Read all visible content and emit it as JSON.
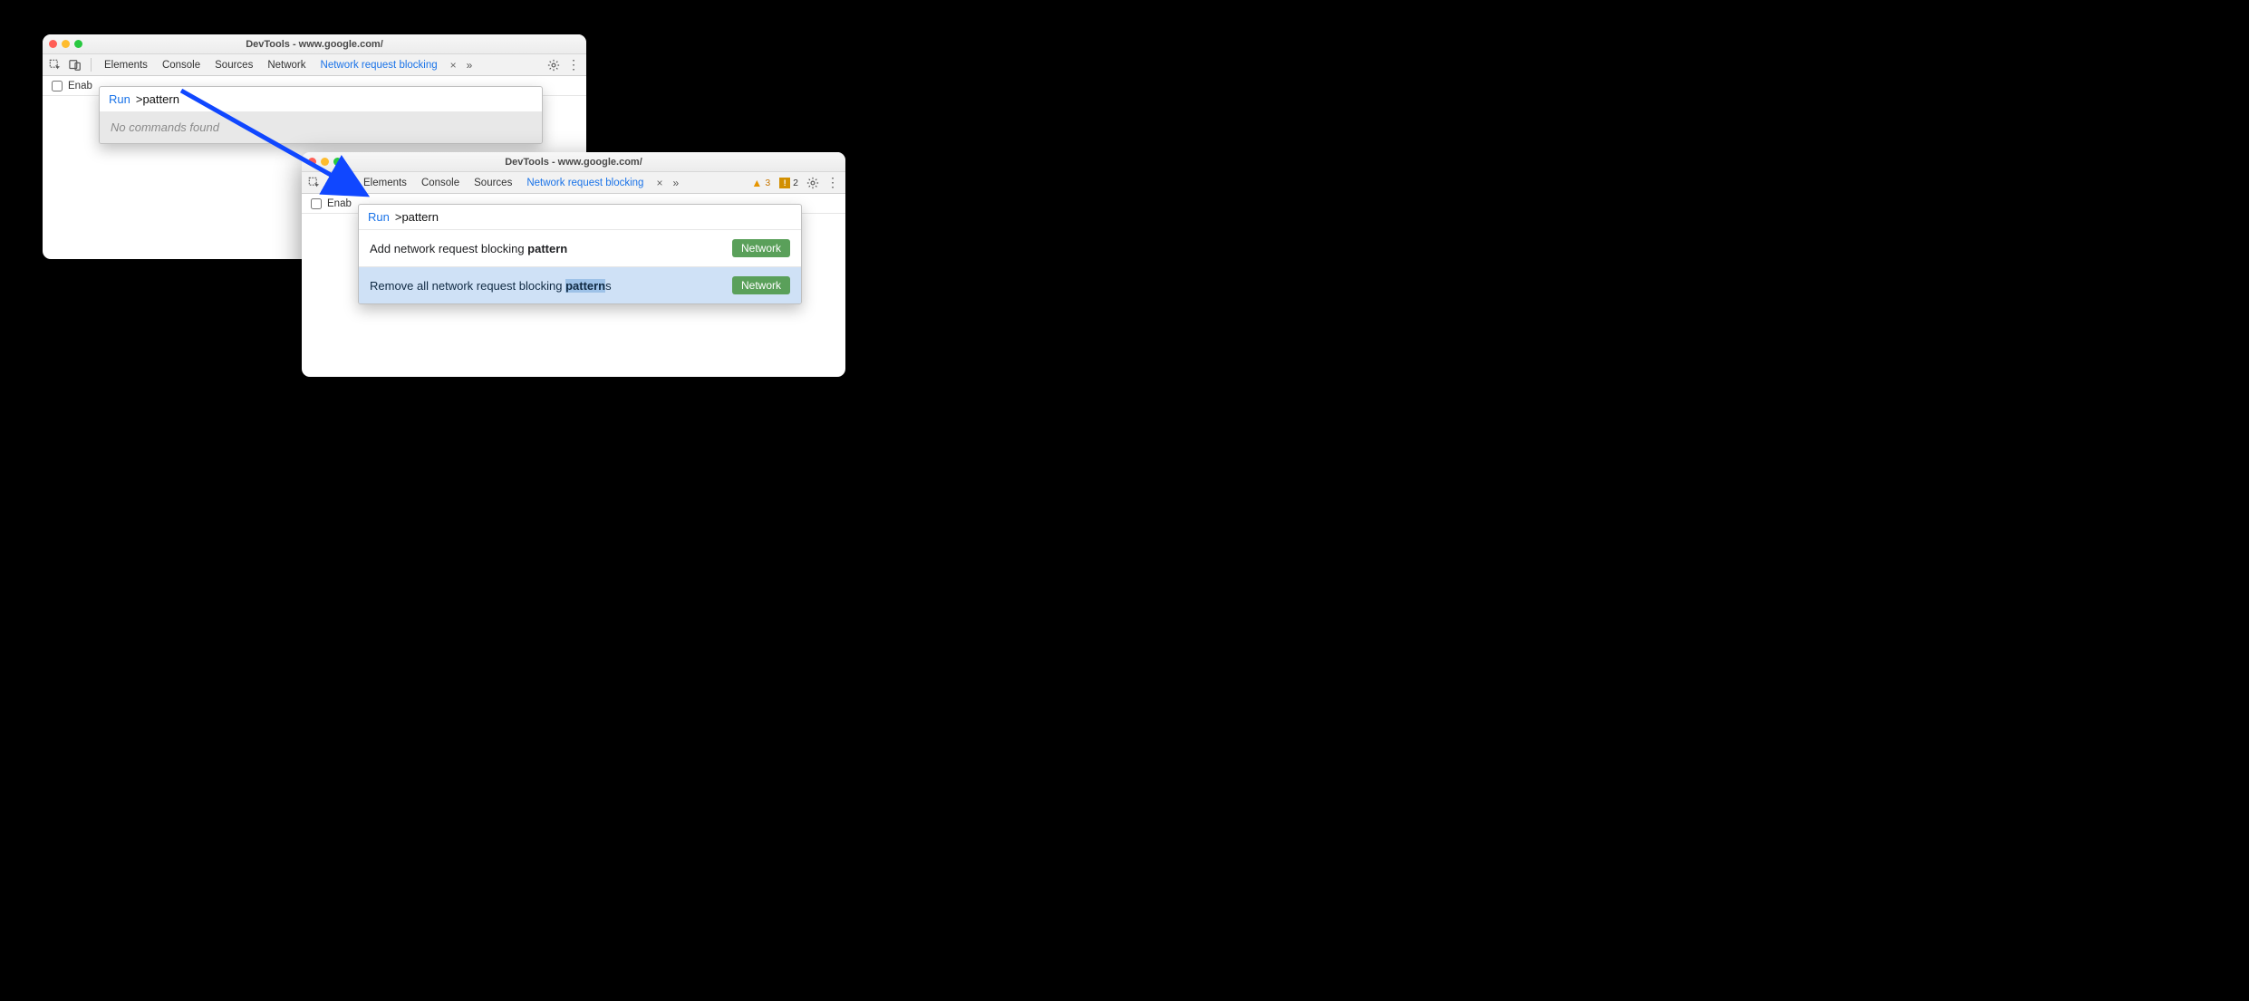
{
  "colors": {
    "accent": "#1a73e8",
    "pill": "#5aa05a"
  },
  "frame1": {
    "title": "DevTools - www.google.com/",
    "tabs": {
      "t1": "Elements",
      "t2": "Console",
      "t3": "Sources",
      "t4": "Network",
      "active": "Network request blocking"
    },
    "subbar": {
      "enable": "Enab"
    },
    "palette": {
      "run": "Run",
      "query": ">pattern",
      "empty": "No commands found"
    }
  },
  "frame2": {
    "title": "DevTools - www.google.com/",
    "tabs": {
      "t1": "Elements",
      "t2": "Console",
      "t3": "Sources",
      "active": "Network request blocking"
    },
    "counts": {
      "warn": "3",
      "info": "2"
    },
    "subbar": {
      "enable": "Enab"
    },
    "palette": {
      "run": "Run",
      "query": ">pattern",
      "rows": [
        {
          "pre": "Add network request blocking ",
          "hl": "pattern",
          "post": "",
          "pill": "Network"
        },
        {
          "pre": "Remove all network request blocking ",
          "hl": "pattern",
          "post": "s",
          "pill": "Network"
        }
      ]
    }
  }
}
